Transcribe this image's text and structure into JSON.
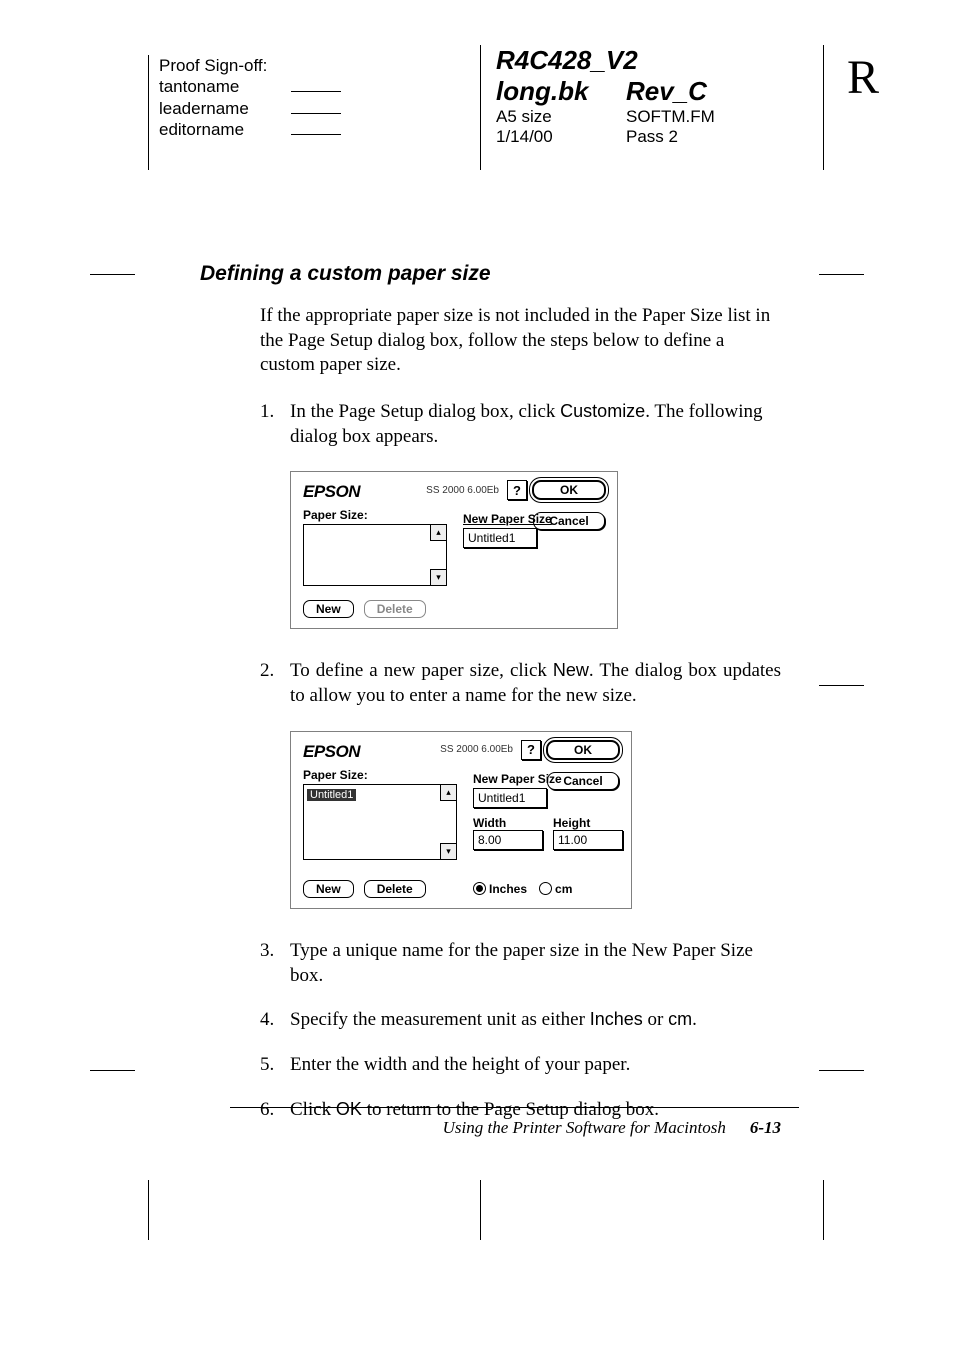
{
  "signoff": {
    "heading": "Proof Sign-off:",
    "lines": [
      "tantoname",
      "leadername",
      "editorname"
    ]
  },
  "doc": {
    "code": "R4C428_V2",
    "file": "long.bk",
    "rev": "Rev_C",
    "size": "A5 size",
    "softfm": "SOFTM.FM",
    "date": "1/14/00",
    "pass": "Pass 2",
    "pageletter": "R"
  },
  "section_heading": "Defining a custom paper size",
  "para_intro": "If the appropriate paper size is not included in the Paper Size list in the Page Setup dialog box, follow the steps below to define a custom paper size.",
  "step1_pre": "In the Page Setup dialog box, click ",
  "step1_cmd": "Customize",
  "step1_post": ". The following dialog box appears.",
  "dialog1": {
    "brand": "EPSON",
    "version": "SS 2000 6.00Eb",
    "help": "?",
    "ok": "OK",
    "cancel": "Cancel",
    "paper_size_label": "Paper Size:",
    "new_size_label": "New Paper Size",
    "new_size_value": "Untitled1",
    "new_btn": "New",
    "delete_btn": "Delete",
    "scroll_up": "▴",
    "scroll_down": "▾"
  },
  "step2_pre": "To define a new paper size, click ",
  "step2_cmd": "New",
  "step2_post": ". The dialog box updates to allow you to enter a name for the new size.",
  "dialog2": {
    "brand": "EPSON",
    "version": "SS 2000 6.00Eb",
    "help": "?",
    "ok": "OK",
    "cancel": "Cancel",
    "paper_size_label": "Paper Size:",
    "list_item": "Untitled1",
    "new_size_label": "New Paper Size",
    "new_size_value": "Untitled1",
    "width_label": "Width",
    "height_label": "Height",
    "width_value": "8.00",
    "height_value": "11.00",
    "new_btn": "New",
    "delete_btn": "Delete",
    "radio_inches": "Inches",
    "radio_cm": "cm",
    "scroll_up": "▴",
    "scroll_down": "▾"
  },
  "step3": "Type a unique name for the paper size in the New Paper Size box.",
  "step4_pre": "Specify the measurement unit as either ",
  "step4_a": "Inches",
  "step4_mid": " or ",
  "step4_b": "cm",
  "step4_post": ".",
  "step5": "Enter the width and the height of your paper.",
  "step6_pre": "Click ",
  "step6_cmd": "OK",
  "step6_post": " to return to the Page Setup dialog box.",
  "footer_title": "Using the Printer Software for Macintosh",
  "footer_page": "6-13",
  "nums": {
    "n1": "1.",
    "n2": "2.",
    "n3": "3.",
    "n4": "4.",
    "n5": "5.",
    "n6": "6."
  }
}
